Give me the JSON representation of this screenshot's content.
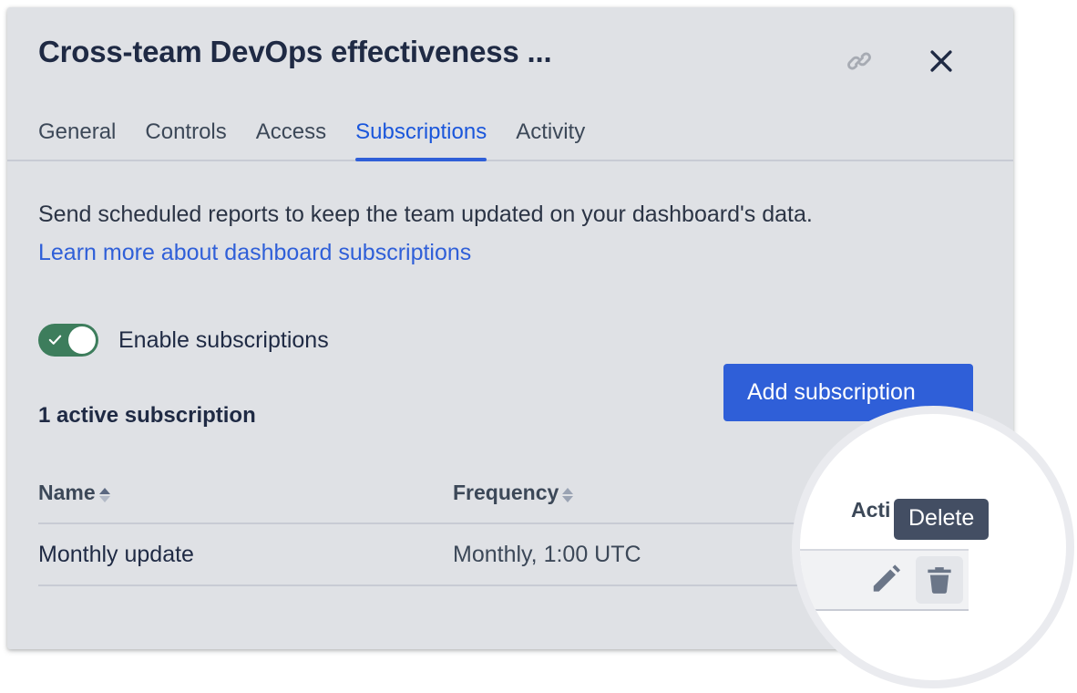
{
  "dialog": {
    "title": "Cross-team DevOps effectiveness ...",
    "link_icon": "link-icon",
    "close_icon": "close-icon"
  },
  "tabs": [
    {
      "label": "General",
      "active": false
    },
    {
      "label": "Controls",
      "active": false
    },
    {
      "label": "Access",
      "active": false
    },
    {
      "label": "Subscriptions",
      "active": true
    },
    {
      "label": "Activity",
      "active": false
    }
  ],
  "body": {
    "intro_text": "Send scheduled reports to keep the team updated on your dashboard's data.",
    "learn_more_link": "Learn more about dashboard subscriptions",
    "toggle_label": "Enable subscriptions",
    "toggle_enabled": true,
    "count_label": "1 active subscription",
    "add_button_label": "Add subscription"
  },
  "table": {
    "columns": [
      {
        "label": "Name",
        "sort": "asc"
      },
      {
        "label": "Frequency",
        "sort": "none"
      },
      {
        "label": "Actions",
        "sort": "none"
      }
    ],
    "rows": [
      {
        "name": "Monthly update",
        "frequency": "Monthly, 1:00 UTC",
        "actions": [
          "edit-icon",
          "delete-icon"
        ]
      }
    ]
  },
  "overlay": {
    "tooltip_label": "Delete",
    "magnified_actions_header": "Acti",
    "edit_icon": "pencil-icon",
    "delete_icon": "trash-icon"
  },
  "colors": {
    "dialog_bg": "#dfe1e5",
    "accent_blue": "#2f5fd8",
    "link_blue": "#2f5fd8",
    "toggle_green": "#3d7d5c",
    "text_dark": "#1f2a44",
    "text_muted": "#3c4858",
    "tooltip_bg": "#434e63",
    "divider": "#c8cbd4"
  }
}
